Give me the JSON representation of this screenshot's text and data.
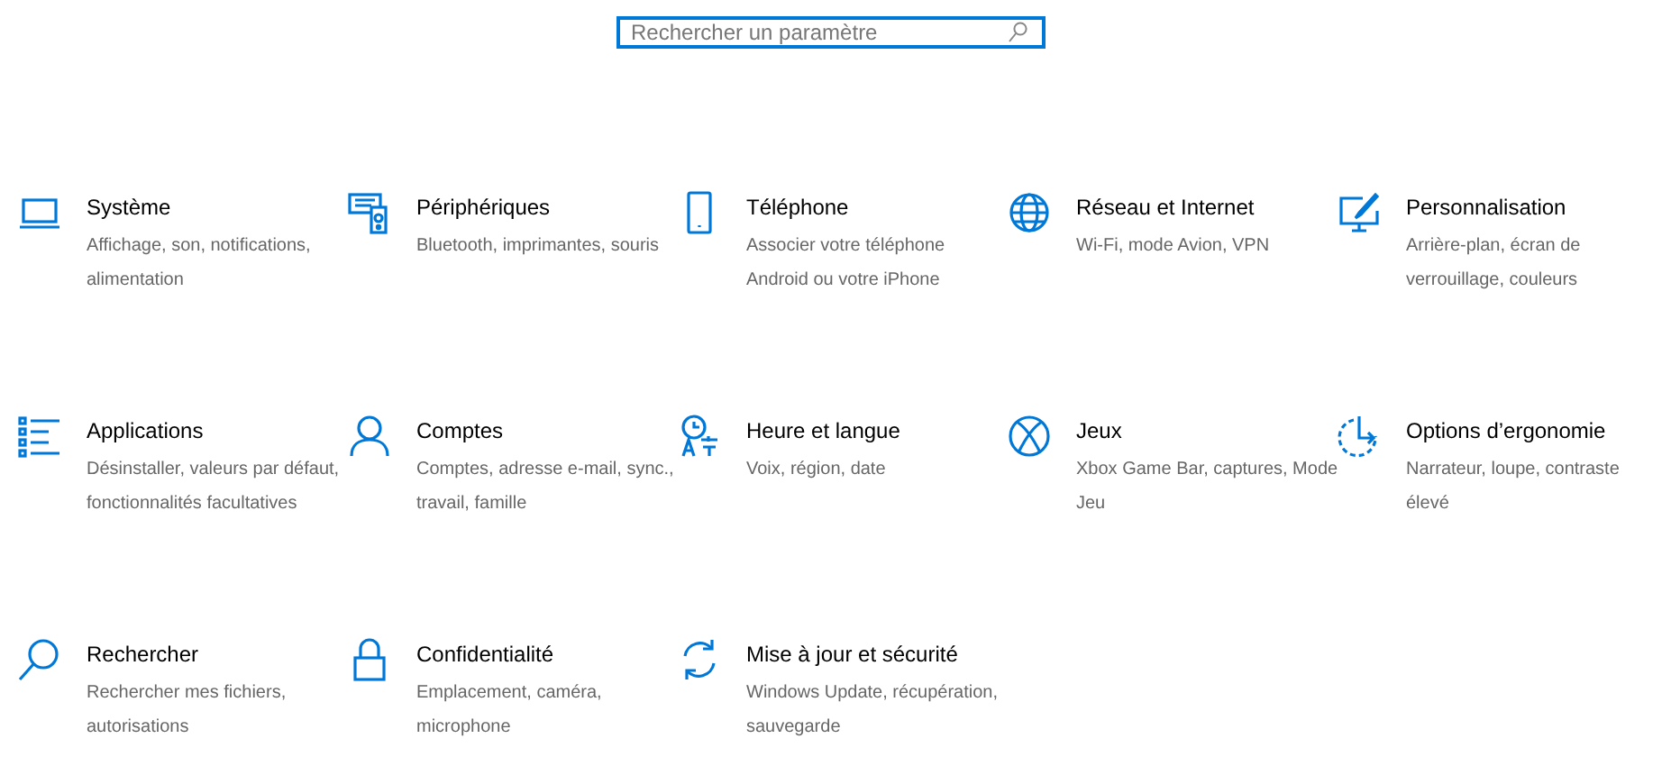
{
  "search": {
    "placeholder": "Rechercher un paramètre"
  },
  "categories": [
    {
      "title": "Système",
      "description_lines": [
        "Affichage, son, notifications,",
        "alimentation"
      ]
    },
    {
      "title": "Périphériques",
      "description_lines": [
        "Bluetooth, imprimantes, souris"
      ]
    },
    {
      "title": "Téléphone",
      "description_lines": [
        "Associer votre téléphone",
        "Android ou votre iPhone"
      ]
    },
    {
      "title": "Réseau et Internet",
      "description_lines": [
        "Wi-Fi, mode Avion, VPN"
      ]
    },
    {
      "title": "Personnalisation",
      "description_lines": [
        "Arrière-plan, écran de",
        "verrouillage, couleurs"
      ]
    },
    {
      "title": "Applications",
      "description_lines": [
        "Désinstaller, valeurs par défaut,",
        "fonctionnalités facultatives"
      ]
    },
    {
      "title": "Comptes",
      "description_lines": [
        "Comptes, adresse e-mail, sync.,",
        "travail, famille"
      ]
    },
    {
      "title": "Heure et langue",
      "description_lines": [
        "Voix, région, date"
      ]
    },
    {
      "title": "Jeux",
      "description_lines": [
        "Xbox Game Bar, captures, Mode",
        "Jeu"
      ]
    },
    {
      "title": "Options d’ergonomie",
      "description_lines": [
        "Narrateur, loupe, contraste",
        "élevé"
      ]
    },
    {
      "title": "Rechercher",
      "description_lines": [
        "Rechercher mes fichiers,",
        "autorisations"
      ]
    },
    {
      "title": "Confidentialité",
      "description_lines": [
        "Emplacement, caméra,",
        "microphone"
      ]
    },
    {
      "title": "Mise à jour et sécurité",
      "description_lines": [
        "Windows Update, récupération,",
        "sauvegarde"
      ]
    }
  ]
}
